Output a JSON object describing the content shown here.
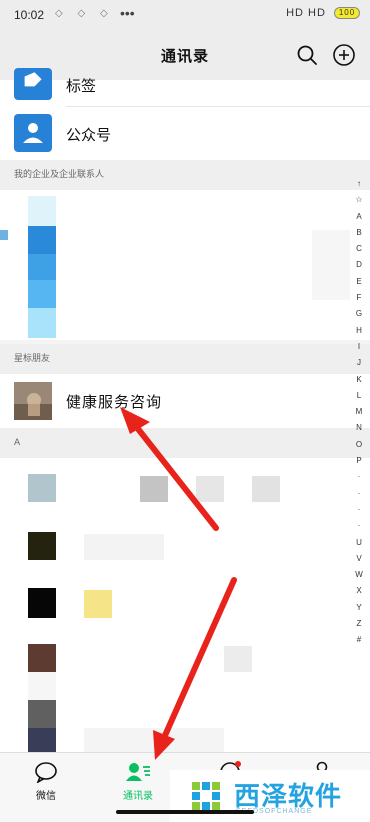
{
  "status_bar": {
    "time": "10:02",
    "left_icons": "◇ ◇ ◇",
    "dots": "•••",
    "right_text": "HD HD",
    "battery": "100"
  },
  "header": {
    "title": "通讯录"
  },
  "rows": {
    "tags_label": "标签",
    "official_accounts_label": "公众号"
  },
  "sections": {
    "enterprise": "我的企业及企业联系人",
    "starred": "星标朋友",
    "letter_a": "A"
  },
  "starred_contact": {
    "name": "健康服务咨询"
  },
  "index_letters": [
    "↑",
    "☆",
    "A",
    "B",
    "C",
    "D",
    "E",
    "F",
    "G",
    "H",
    "I",
    "J",
    "K",
    "L",
    "M",
    "N",
    "O",
    "P",
    "·",
    "·",
    "·",
    "·",
    "U",
    "V",
    "W",
    "X",
    "Y",
    "Z",
    "#"
  ],
  "tabs": {
    "chats": "微信",
    "contacts": "通讯录",
    "discover": "发现",
    "me": "我"
  },
  "watermark": {
    "title": "西泽软件",
    "subtitle": "SEEDSOFCHANGE"
  },
  "colors": {
    "accent_green": "#07c160",
    "icon_blue": "#2782d7",
    "arrow_red": "#e8231c"
  }
}
